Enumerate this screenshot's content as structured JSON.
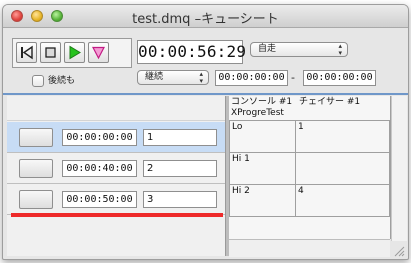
{
  "window": {
    "title": "test.dmq –キューシート"
  },
  "transport": {
    "buttons": [
      {
        "name": "rewind-to-start",
        "icon": "skip-to-start-icon"
      },
      {
        "name": "stop",
        "icon": "stop-icon"
      },
      {
        "name": "play",
        "icon": "play-icon",
        "color": "#26c21e"
      },
      {
        "name": "pause",
        "icon": "pause-triangle-icon",
        "color": "#e61f9c"
      }
    ]
  },
  "current_time": "00:00:56:29",
  "mode_popup": {
    "selected": "自走"
  },
  "continue_popup": {
    "selected": "継続"
  },
  "range": {
    "start": "00:00:00:00",
    "separator": "-",
    "end": "00:00:00:00"
  },
  "followup_checkbox": {
    "label": "後続も",
    "checked": false
  },
  "cues": [
    {
      "time": "00:00:00:00",
      "number": "1",
      "selected": true
    },
    {
      "time": "00:00:40:00",
      "number": "2",
      "selected": false
    },
    {
      "time": "00:00:50:00",
      "number": "3",
      "selected": false
    }
  ],
  "grid": {
    "console_header": "コンソール #1",
    "chaser_header": "チェイサー #1",
    "device_name": "XProgreTest",
    "rows": [
      {
        "label": "Lo",
        "value": "1"
      },
      {
        "label": "Hi 1",
        "value": ""
      },
      {
        "label": "Hi 2",
        "value": "4"
      }
    ]
  },
  "colors": {
    "accent": "#6f97c9",
    "selection": "#c7dcf5",
    "playhead": "#ee2a2a"
  }
}
